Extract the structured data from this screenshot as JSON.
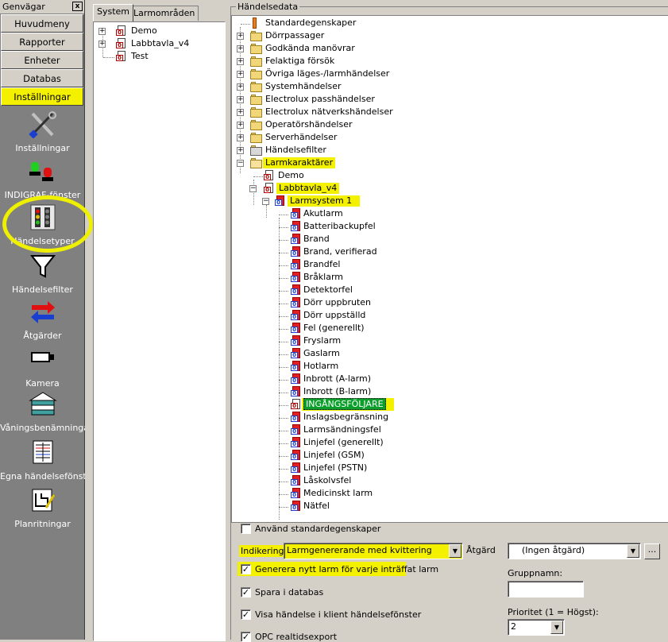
{
  "sidebar": {
    "title": "Genvägar",
    "close": "x",
    "nav": [
      "Huvudmeny",
      "Rapporter",
      "Enheter",
      "Databas",
      "Inställningar"
    ],
    "shortcuts": [
      {
        "label": "Inställningar",
        "icon": "tools-icon"
      },
      {
        "label": "INDIGRAF-fönster",
        "icon": "indicator-lamps-icon"
      },
      {
        "label": "Händelsetyper",
        "icon": "traffic-light-icon"
      },
      {
        "label": "Händelsefilter",
        "icon": "filter-funnel-icon"
      },
      {
        "label": "Åtgärder",
        "icon": "arrows-icon"
      },
      {
        "label": "Kamera",
        "icon": "camera-icon"
      },
      {
        "label": "Våningsbenämningar",
        "icon": "building-floors-icon"
      },
      {
        "label": "Egna händelsefönster",
        "icon": "event-window-icon"
      },
      {
        "label": "Planritningar",
        "icon": "floor-plan-icon"
      }
    ]
  },
  "middle": {
    "tabs": [
      "System",
      "Larmområden"
    ],
    "tree": [
      "Demo",
      "Labbtavla_v4",
      "Test"
    ]
  },
  "right": {
    "group_title": "Händelsedata",
    "tree_top": [
      "Standardegenskaper",
      "Dörrpassager",
      "Godkända manövrar",
      "Felaktiga försök",
      "Övriga läges-/larmhändelser",
      "Systemhändelser",
      "Electrolux passhändelser",
      "Electrolux nätverkshändelser",
      "Operatörshändelser",
      "Serverhändelser",
      "Händelsefilter"
    ],
    "larmkaraktarer": "Larmkaraktärer",
    "demo": "Demo",
    "labbtavla": "Labbtavla_v4",
    "larmsystem": "Larmsystem  1",
    "alarms": [
      "Akutlarm",
      "Batteribackupfel",
      "Brand",
      "Brand, verifierad",
      "Brandfel",
      "Bråklarm",
      "Detektorfel",
      "Dörr uppbruten",
      "Dörr uppställd",
      "Fel (generellt)",
      "Fryslarm",
      "Gaslarm",
      "Hotlarm",
      "Inbrott (A-larm)",
      "Inbrott (B-larm)",
      "INGÅNGSFÖLJARE",
      "Inslagsbegränsning",
      "Larmsändningsfel",
      "Linjefel (generellt)",
      "Linjefel (GSM)",
      "Linjefel (PSTN)",
      "Låskolvsfel",
      "Medicinskt larm",
      "Nätfel"
    ],
    "selected_alarm": "INGÅNGSFÖLJARE"
  },
  "bottom": {
    "use_standard": "Använd standardegenskaper",
    "indikering_label": "Indikering",
    "indikering_value": "Larmgenererande med kvittering",
    "atgard_label": "Åtgärd",
    "atgard_value": "(Ingen åtgärd)",
    "more_btn": "...",
    "generera": "Generera nytt larm för varje inträffat larm",
    "spara": "Spara i databas",
    "visa": "Visa händelse i klient händelsefönster",
    "opc": "OPC realtidsexport",
    "gruppnamn_label": "Gruppnamn:",
    "gruppnamn_value": "",
    "prioritet_label": "Prioritet (1 = Högst):",
    "prioritet_value": "2",
    "checkmark": "✓"
  },
  "colors": {
    "highlight": "#f3f000",
    "selection": "#0a9f2a",
    "sidebar_bg": "#808080"
  }
}
